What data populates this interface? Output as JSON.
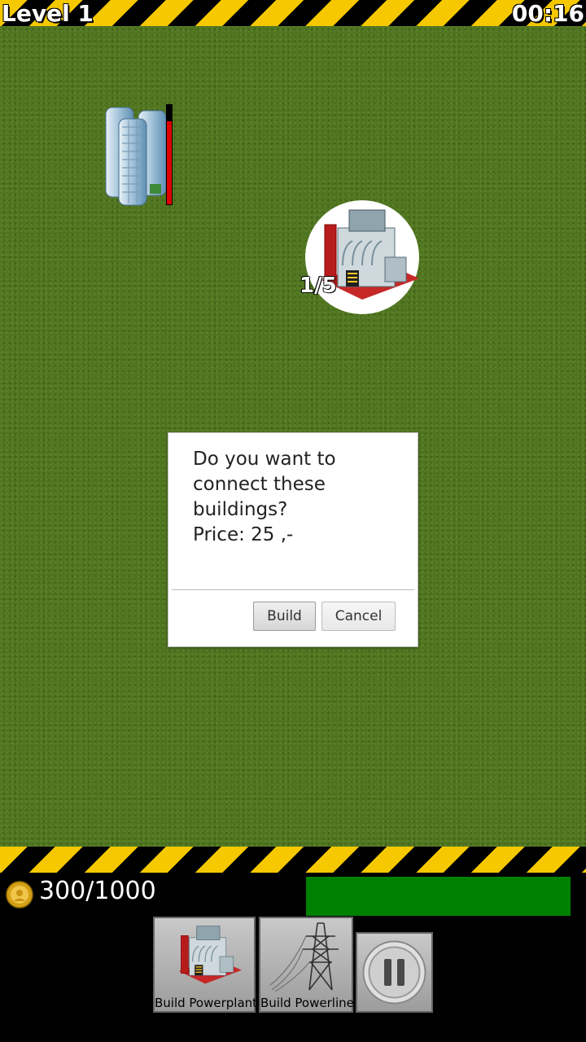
{
  "hud": {
    "level": "Level 1",
    "timer": "00:16"
  },
  "map": {
    "city": {
      "name": "apartment-towers",
      "demand_level": 0.82
    },
    "powerplant": {
      "count": "1/5"
    }
  },
  "dialog": {
    "message_lines": [
      "Do you want to",
      "connect these",
      "buildings?",
      "Price: 25 ,-"
    ],
    "build_label": "Build",
    "cancel_label": "Cancel"
  },
  "status": {
    "money": "300/1000",
    "progress": 1.0,
    "progress_color": "#008000"
  },
  "toolbar": {
    "powerplant_label": "Build Powerplant",
    "powerline_label": "Build Powerline",
    "pause_icon": "pause-icon"
  },
  "colors": {
    "hazard_yellow": "#f5c800",
    "grass": "#4f7420",
    "demand_red": "#e00000"
  }
}
